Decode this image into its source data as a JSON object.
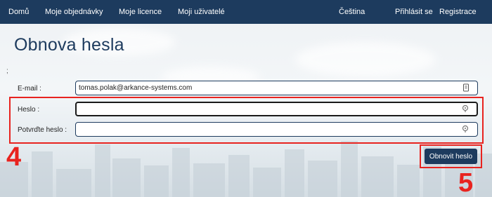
{
  "nav": {
    "home": "Domů",
    "orders": "Moje objednávky",
    "licences": "Moje licence",
    "users": "Moji uživatelé",
    "language": "Čeština",
    "login": "Přihlásit se",
    "register": "Registrace"
  },
  "page": {
    "title": "Obnova hesla",
    "bullet": ";"
  },
  "form": {
    "email_label": "E-mail :",
    "email_value": "tomas.polak@arkance-systems.com",
    "password_label": "Heslo :",
    "password_value": "",
    "confirm_label": "Potvrďte heslo :",
    "confirm_value": "",
    "submit_label": "Obnovit heslo"
  },
  "annotations": {
    "step_4": "4",
    "step_5": "5"
  },
  "colors": {
    "navbar": "#1d3b5e",
    "accent": "#1d3b5e",
    "annotation": "#e8231f"
  },
  "icons": {
    "email_field": "contact-card-icon",
    "password_field": "key-icon",
    "confirm_field": "key-icon"
  }
}
